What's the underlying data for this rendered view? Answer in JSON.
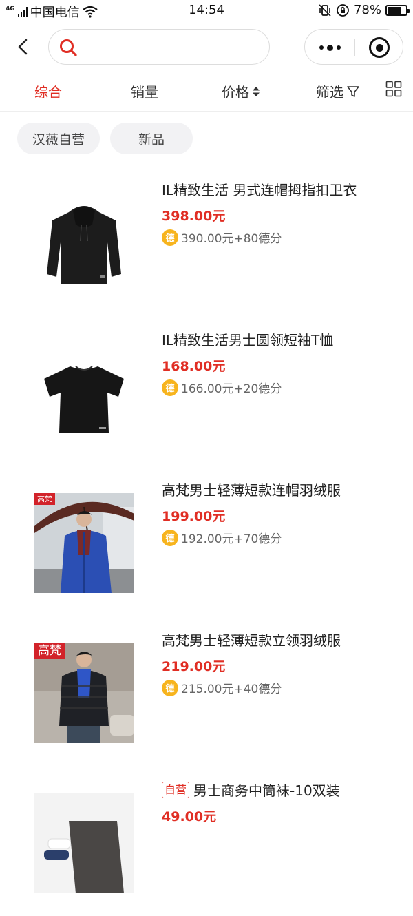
{
  "status_bar": {
    "network": "4G",
    "carrier": "中国电信",
    "time": "14:54",
    "battery_text": "78%",
    "battery_level": 0.78
  },
  "search": {
    "value": "",
    "placeholder": ""
  },
  "sort_tabs": [
    {
      "label": "综合",
      "active": true
    },
    {
      "label": "销量",
      "active": false
    },
    {
      "label": "价格",
      "active": false
    },
    {
      "label": "筛选",
      "active": false
    }
  ],
  "filter_tags": [
    "汉薇自营",
    "新品"
  ],
  "products": [
    {
      "name": "IL精致生活 男式连帽拇指扣卫衣",
      "price": "398.00元",
      "points": "390.00元+80德分",
      "image": "black-hoodie"
    },
    {
      "name": "IL精致生活男士圆领短袖T恤",
      "price": "168.00元",
      "points": "166.00元+20德分",
      "image": "black-tshirt"
    },
    {
      "name": "高梵男士轻薄短款连帽羽绒服",
      "price": "199.00元",
      "points": "192.00元+70德分",
      "image": "blue-down-jacket-umbrella",
      "brand_badge": "高梵"
    },
    {
      "name": "高梵男士轻薄短款立领羽绒服",
      "price": "219.00元",
      "points": "215.00元+40德分",
      "image": "black-down-jacket",
      "brand_badge": "高梵"
    },
    {
      "name": "男士商务中筒袜-10双装",
      "price": "49.00元",
      "self_badge": "自营",
      "image": "business-socks"
    }
  ],
  "coin_glyph": "德",
  "colors": {
    "accent": "#e02e24",
    "coin": "#f7b41e",
    "tag_bg": "#f2f2f4"
  }
}
